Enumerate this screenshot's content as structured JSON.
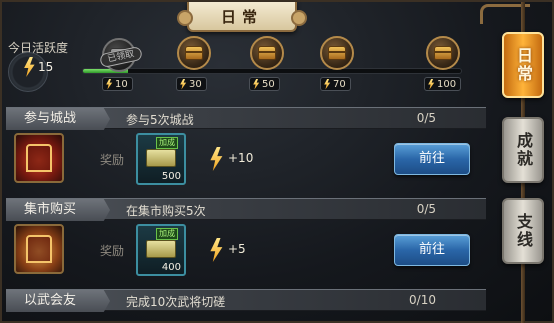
{
  "window": {
    "title": "日常"
  },
  "activity": {
    "label": "今日活跃度",
    "value": "15",
    "progress_fraction": 0.12
  },
  "milestones": [
    {
      "points": "10",
      "claimed": true,
      "claimed_label": "已领取"
    },
    {
      "points": "30",
      "claimed": false
    },
    {
      "points": "50",
      "claimed": false
    },
    {
      "points": "70",
      "claimed": false
    },
    {
      "points": "100",
      "claimed": false
    }
  ],
  "side_tabs": [
    {
      "label": "日常",
      "active": true
    },
    {
      "label": "成就",
      "active": false
    },
    {
      "label": "支线",
      "active": false
    }
  ],
  "quests": [
    {
      "name": "参与城战",
      "description": "参与5次城战",
      "progress": "0/5",
      "reward_label": "奖励",
      "item_badge": "加成",
      "item_count": "500",
      "activity_reward": "+10",
      "button_label": "前往"
    },
    {
      "name": "集市购买",
      "description": "在集市购买5次",
      "progress": "0/5",
      "reward_label": "奖励",
      "item_badge": "加成",
      "item_count": "400",
      "activity_reward": "+5",
      "button_label": "前往"
    },
    {
      "name": "以武会友",
      "description": "完成10次武将切磋",
      "progress": "0/10"
    }
  ],
  "icons": {
    "activity": "lightning-bolt-icon",
    "milestone": "treasure-chest-icon",
    "quest_0": "city-battle-gate-icon",
    "quest_1": "market-chest-icon",
    "reward_item": "bonus-ticket-icon"
  },
  "colors": {
    "active_tab": "#ffb43a",
    "button": "#2a66a8",
    "progress": "#4fc43e",
    "bolt": "#f2a41e"
  }
}
